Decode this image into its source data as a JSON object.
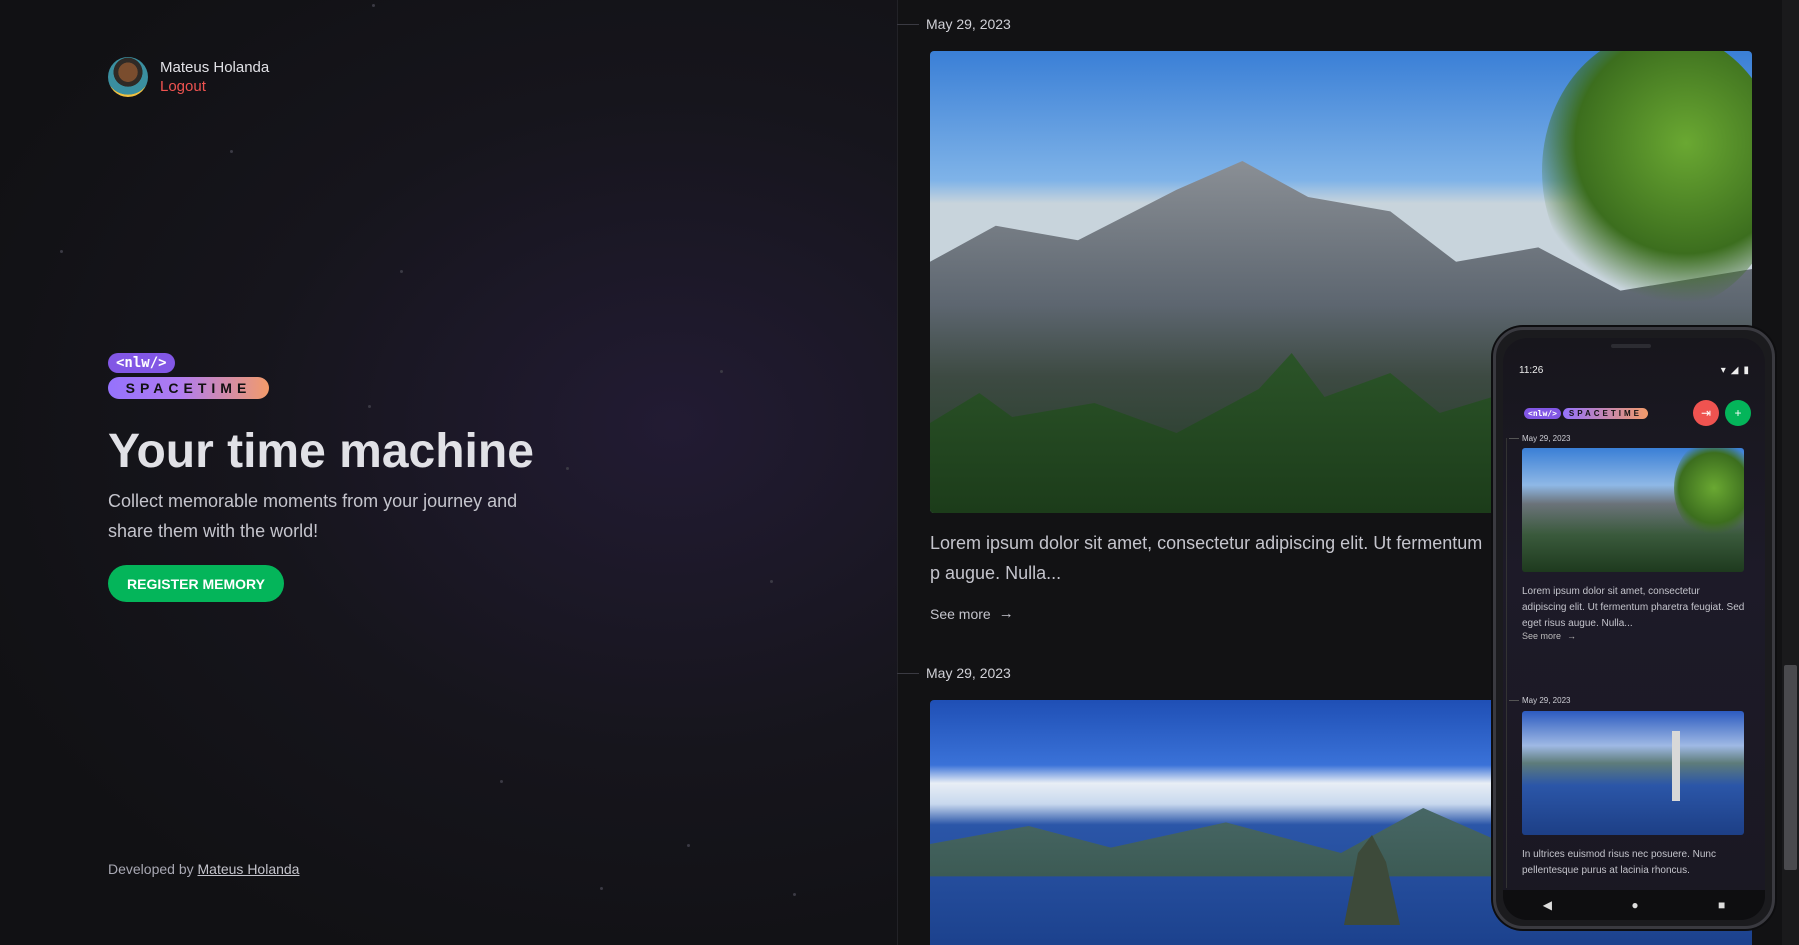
{
  "user": {
    "name": "Mateus Holanda",
    "logout_label": "Logout"
  },
  "brand": {
    "nlw": "<nlw/>",
    "spacetime": "SPACETIME"
  },
  "hero": {
    "title": "Your time machine",
    "subtitle": "Collect memorable moments from your journey and share them with the world!",
    "register_label": "REGISTER MEMORY"
  },
  "footer": {
    "prefix": "Developed by ",
    "author": "Mateus Holanda"
  },
  "feed": {
    "entries": [
      {
        "date": "May 29, 2023",
        "excerpt": "Lorem ipsum dolor sit amet, consectetur adipiscing elit. Ut fermentum p augue. Nulla...",
        "see_more": "See more"
      },
      {
        "date": "May 29, 2023"
      }
    ]
  },
  "phone": {
    "time": "11:26",
    "entries": [
      {
        "date": "May 29, 2023",
        "excerpt": "Lorem ipsum dolor sit amet, consectetur adipiscing elit. Ut fermentum pharetra feugiat. Sed eget risus augue. Nulla...",
        "see_more": "See more"
      },
      {
        "date": "May 29, 2023",
        "excerpt": "In ultrices euismod risus nec posuere. Nunc pellentesque purus at lacinia rhoncus."
      }
    ]
  },
  "colors": {
    "accent_green": "#04b55a",
    "accent_purple": "#8257e5",
    "logout_red": "#ef5350"
  },
  "icons": {
    "arrow": "arrow-right-icon",
    "logout": "logout-icon",
    "add": "plus-icon"
  }
}
